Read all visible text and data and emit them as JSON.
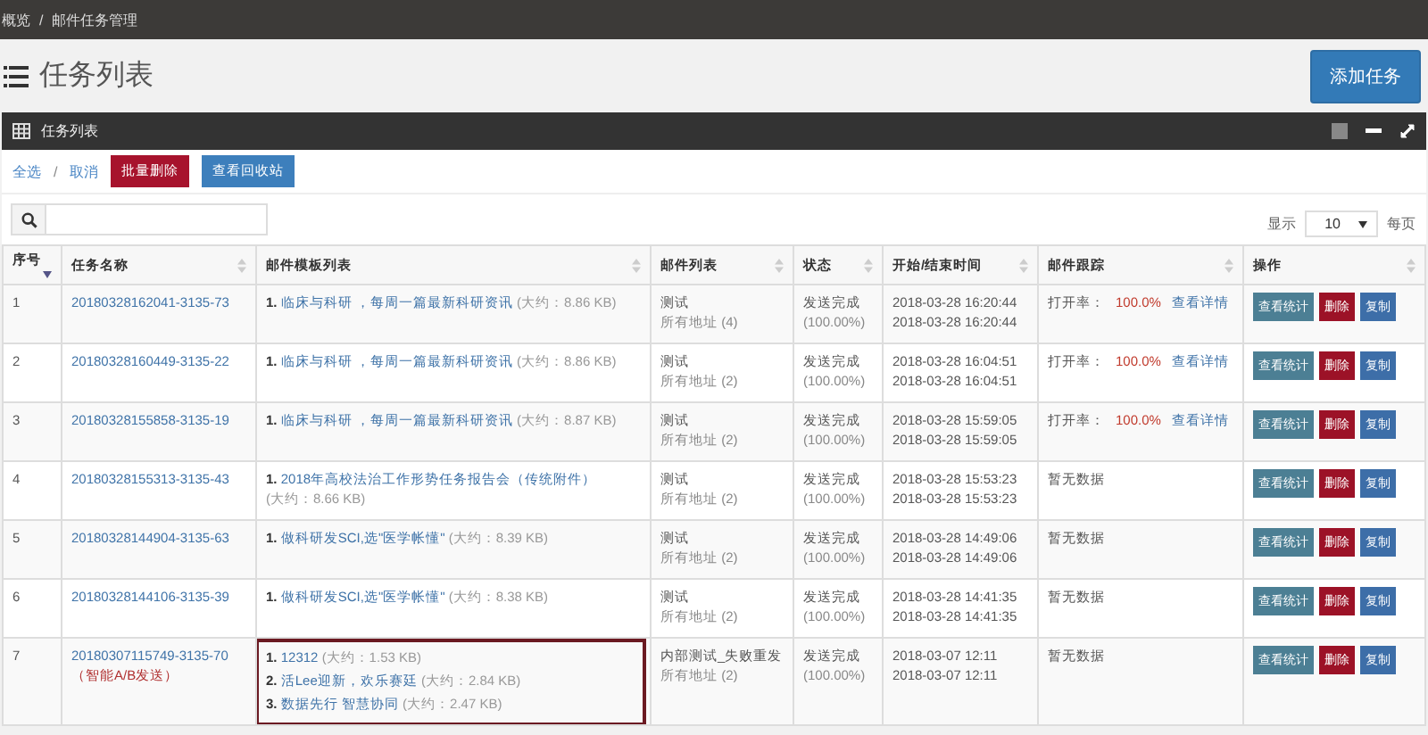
{
  "breadcrumb": [
    "概览",
    "/",
    "邮件任务管理"
  ],
  "page_title": "任务列表",
  "add_button": "添加任务",
  "panel": {
    "title": "任务列表"
  },
  "toolbar": {
    "select_all": "全选",
    "separator": "/",
    "cancel": "取消",
    "batch_delete": "批量删除",
    "recycle_bin": "查看回收站"
  },
  "page_size": {
    "prefix": "显示",
    "value": "10",
    "suffix": "每页"
  },
  "table": {
    "columns": [
      "序号",
      "任务名称",
      "邮件模板列表",
      "邮件列表",
      "状态",
      "开始/结束时间",
      "邮件跟踪",
      "操作"
    ],
    "rows": [
      {
        "index": "1",
        "name": "20180328162041-3135-73",
        "tag": null,
        "highlighted": false,
        "templates": [
          {
            "num": "1.",
            "title": "临床与科研 ，每周一篇最新科研资讯",
            "size": "(大约：8.86 KB)"
          }
        ],
        "list_name": "测试",
        "list_addr": "所有地址 (4)",
        "status": "发送完成",
        "percent": "(100.00%)",
        "start": "2018-03-28 16:20:44",
        "end": "2018-03-28 16:20:44",
        "tracking": {
          "kind": "rate",
          "label": "打开率：",
          "value": "100.0%",
          "link": "查看详情"
        },
        "actions": [
          "查看统计",
          "删除",
          "复制"
        ]
      },
      {
        "index": "2",
        "name": "20180328160449-3135-22",
        "tag": null,
        "highlighted": false,
        "templates": [
          {
            "num": "1.",
            "title": "临床与科研 ，每周一篇最新科研资讯",
            "size": "(大约：8.86 KB)"
          }
        ],
        "list_name": "测试",
        "list_addr": "所有地址 (2)",
        "status": "发送完成",
        "percent": "(100.00%)",
        "start": "2018-03-28 16:04:51",
        "end": "2018-03-28 16:04:51",
        "tracking": {
          "kind": "rate",
          "label": "打开率：",
          "value": "100.0%",
          "link": "查看详情"
        },
        "actions": [
          "查看统计",
          "删除",
          "复制"
        ]
      },
      {
        "index": "3",
        "name": "20180328155858-3135-19",
        "tag": null,
        "highlighted": false,
        "templates": [
          {
            "num": "1.",
            "title": "临床与科研 ，每周一篇最新科研资讯",
            "size": "(大约：8.87 KB)"
          }
        ],
        "list_name": "测试",
        "list_addr": "所有地址 (2)",
        "status": "发送完成",
        "percent": "(100.00%)",
        "start": "2018-03-28 15:59:05",
        "end": "2018-03-28 15:59:05",
        "tracking": {
          "kind": "rate",
          "label": "打开率：",
          "value": "100.0%",
          "link": "查看详情"
        },
        "actions": [
          "查看统计",
          "删除",
          "复制"
        ]
      },
      {
        "index": "4",
        "name": "20180328155313-3135-43",
        "tag": null,
        "highlighted": false,
        "templates": [
          {
            "num": "1.",
            "title": "2018年高校法治工作形势任务报告会（传统附件）",
            "size": "(大约：8.66 KB)"
          }
        ],
        "list_name": "测试",
        "list_addr": "所有地址 (2)",
        "status": "发送完成",
        "percent": "(100.00%)",
        "start": "2018-03-28 15:53:23",
        "end": "2018-03-28 15:53:23",
        "tracking": {
          "kind": "none",
          "label": "暂无数据"
        },
        "actions": [
          "查看统计",
          "删除",
          "复制"
        ]
      },
      {
        "index": "5",
        "name": "20180328144904-3135-63",
        "tag": null,
        "highlighted": false,
        "templates": [
          {
            "num": "1.",
            "title": "做科研发SCI,选\"医学帐懂\"",
            "size": "(大约：8.39 KB)"
          }
        ],
        "list_name": "测试",
        "list_addr": "所有地址 (2)",
        "status": "发送完成",
        "percent": "(100.00%)",
        "start": "2018-03-28 14:49:06",
        "end": "2018-03-28 14:49:06",
        "tracking": {
          "kind": "none",
          "label": "暂无数据"
        },
        "actions": [
          "查看统计",
          "删除",
          "复制"
        ]
      },
      {
        "index": "6",
        "name": "20180328144106-3135-39",
        "tag": null,
        "highlighted": false,
        "templates": [
          {
            "num": "1.",
            "title": "做科研发SCI,选\"医学帐懂\"",
            "size": "(大约：8.38 KB)"
          }
        ],
        "list_name": "测试",
        "list_addr": "所有地址 (2)",
        "status": "发送完成",
        "percent": "(100.00%)",
        "start": "2018-03-28 14:41:35",
        "end": "2018-03-28 14:41:35",
        "tracking": {
          "kind": "none",
          "label": "暂无数据"
        },
        "actions": [
          "查看统计",
          "删除",
          "复制"
        ]
      },
      {
        "index": "7",
        "name": "20180307115749-3135-70",
        "tag": "（智能A/B发送）",
        "highlighted": true,
        "templates": [
          {
            "num": "1.",
            "title": "12312",
            "size": "(大约：1.53 KB)"
          },
          {
            "num": "2.",
            "title": "活Lee迎新，欢乐赛廷",
            "size": "(大约：2.84 KB)"
          },
          {
            "num": "3.",
            "title": "数据先行 智慧协同",
            "size": "(大约：2.47 KB)"
          }
        ],
        "list_name": "内部测试_失败重发",
        "list_addr": "所有地址 (2)",
        "status": "发送完成",
        "percent": "(100.00%)",
        "start": "2018-03-07 12:11",
        "end": "2018-03-07 12:11",
        "tracking": {
          "kind": "none",
          "label": "暂无数据"
        },
        "actions": [
          "查看统计",
          "删除",
          "复制"
        ]
      }
    ]
  }
}
